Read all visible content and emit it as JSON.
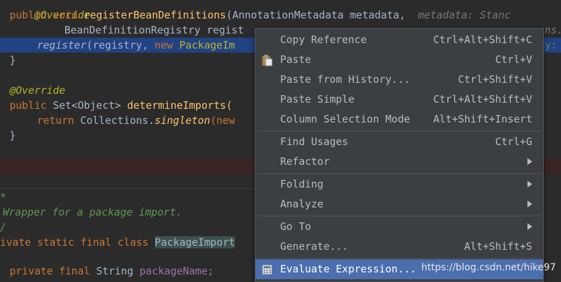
{
  "code": {
    "l0": "@Override",
    "l1_a": "public",
    "l1_b": "void",
    "l1_c": "registerBeanDefinitions",
    "l1_d": "(AnnotationMetadata metadata,",
    "l1_hint": "metadata: Stanc",
    "l2": "BeanDefinitionRegistry regist",
    "l2_tail": "ns.",
    "l3_a": "register",
    "l3_b": "(registry,",
    "l3_c": "new",
    "l3_d": "PackageIm",
    "l3_tail": "y:",
    "l4": "}",
    "l6": "@Override",
    "l7_a": "public",
    "l7_b": "Set<Object>",
    "l7_c": "determineImports(",
    "l8_a": "return",
    "l8_b": "Collections.",
    "l8_c": "singleton",
    "l8_d": "(new",
    "l9": "}",
    "l12": "*",
    "l13": "Wrapper for a package import.",
    "l14": "/",
    "l15_a": "ivate",
    "l15_b": "static",
    "l15_c": "final",
    "l15_d": "class",
    "l15_e": "PackageImport",
    "l17_a": "private",
    "l17_b": "final",
    "l17_c": "String",
    "l17_d": "packageName;"
  },
  "menu": {
    "items": [
      {
        "label": "Copy Reference",
        "shortcut": "Ctrl+Alt+Shift+C"
      },
      {
        "label": "Paste",
        "shortcut": "Ctrl+V"
      },
      {
        "label": "Paste from History...",
        "shortcut": "Ctrl+Shift+V"
      },
      {
        "label": "Paste Simple",
        "shortcut": "Ctrl+Alt+Shift+V"
      },
      {
        "label": "Column Selection Mode",
        "shortcut": "Alt+Shift+Insert"
      },
      {
        "label": "Find Usages",
        "shortcut": "Ctrl+G"
      },
      {
        "label": "Refactor",
        "shortcut": ""
      },
      {
        "label": "Folding",
        "shortcut": ""
      },
      {
        "label": "Analyze",
        "shortcut": ""
      },
      {
        "label": "Go To",
        "shortcut": ""
      },
      {
        "label": "Generate...",
        "shortcut": "Alt+Shift+S"
      },
      {
        "label": "Evaluate Expression...",
        "shortcut": ""
      }
    ]
  },
  "watermark": "https://blog.csdn.net/hike97",
  "colors": {
    "menu_bg": "#3c3f41",
    "active": "#4b6eaf",
    "editor_bg": "#2b2b2b"
  }
}
